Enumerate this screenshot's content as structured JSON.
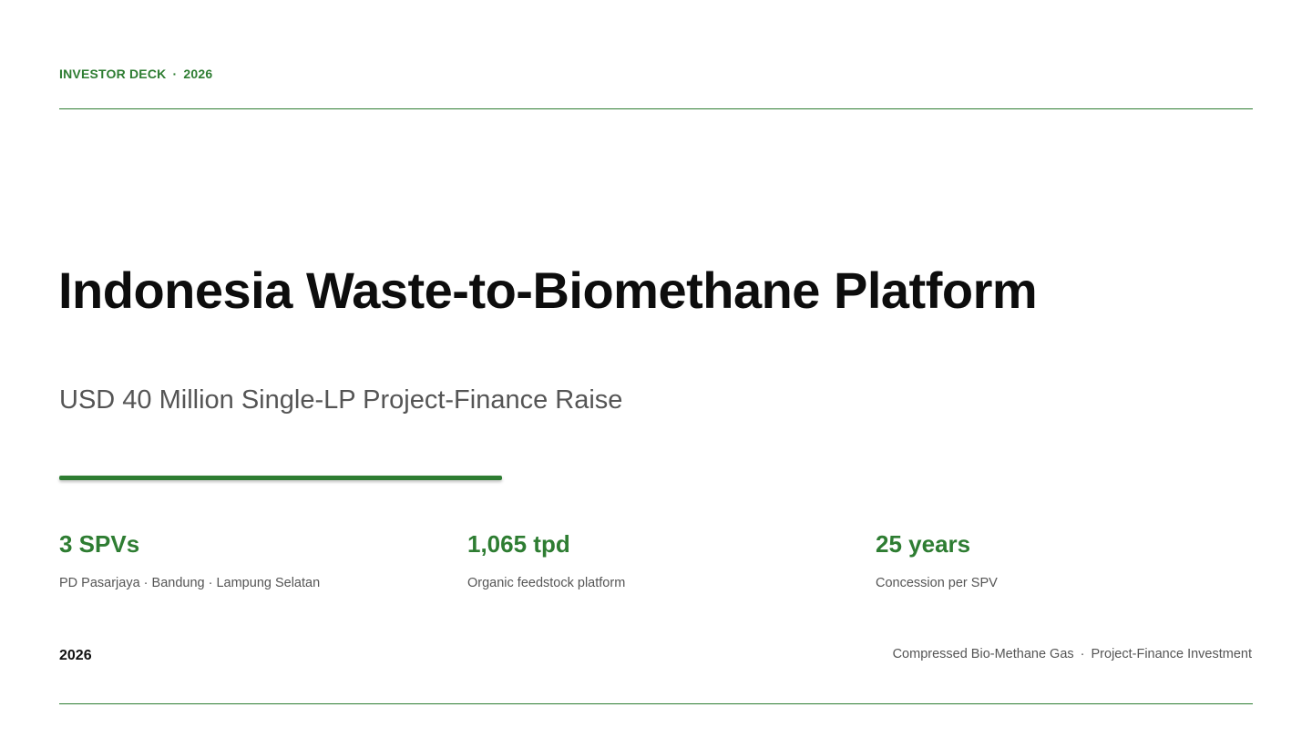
{
  "header": {
    "label": "INVESTOR DECK",
    "separator": "·",
    "year": "2026"
  },
  "title": "Indonesia Waste-to-Biomethane Platform",
  "subtitle": "USD 40 Million Single-LP Project-Finance Raise",
  "stats": [
    {
      "value": "3 SPVs",
      "label": "PD Pasarjaya · Bandung · Lampung Selatan"
    },
    {
      "value": "1,065 tpd",
      "label": "Organic feedstock platform"
    },
    {
      "value": "25 years",
      "label": "Concession per SPV"
    }
  ],
  "footer": {
    "year": "2026",
    "left_tag": "Compressed Bio-Methane Gas",
    "separator": "·",
    "right_tag": "Project-Finance Investment"
  },
  "colors": {
    "accent": "#2e7d32",
    "text": "#111111",
    "muted": "#555555",
    "background": "#ffffff"
  }
}
